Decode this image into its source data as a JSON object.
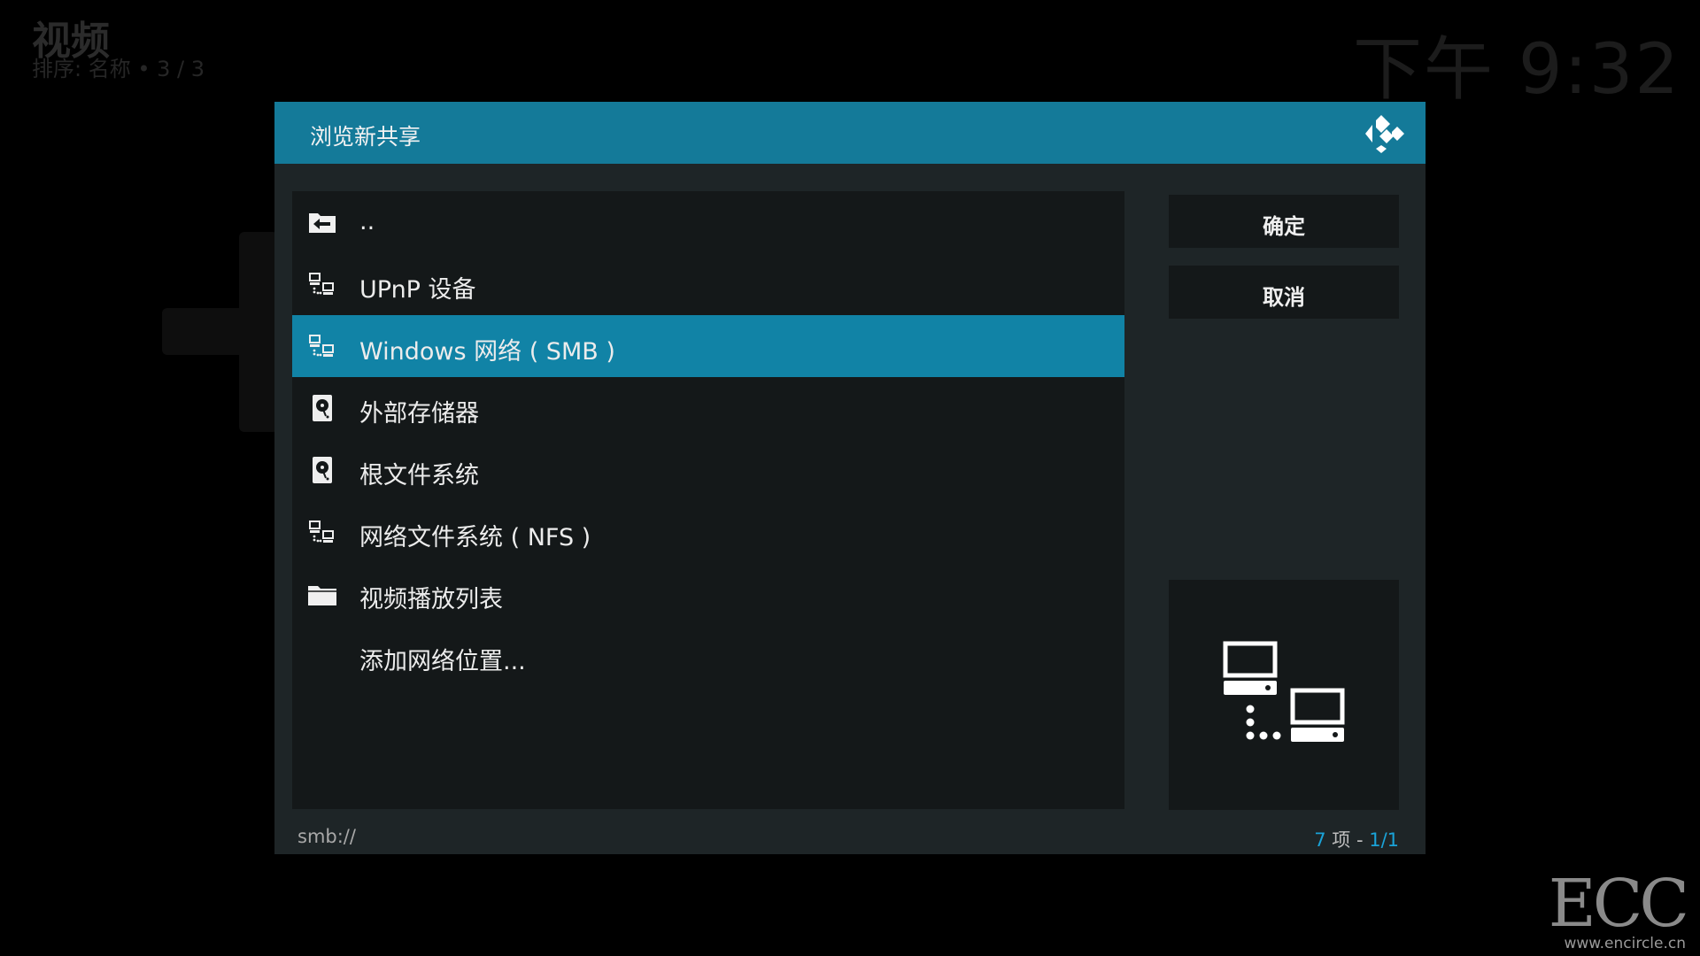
{
  "background": {
    "title": "视频",
    "subtitle": "排序: 名称  •  3 / 3",
    "clock": "下午 9:32"
  },
  "dialog": {
    "title": "浏览新共享",
    "logo_icon": "kodi-logo-icon",
    "items": [
      {
        "label": "..",
        "icon": "folder-back-icon"
      },
      {
        "label": "UPnP 设备",
        "icon": "network-icon"
      },
      {
        "label": "Windows 网络 ( SMB )",
        "icon": "network-icon",
        "selected": true
      },
      {
        "label": "外部存储器",
        "icon": "harddisk-icon"
      },
      {
        "label": "根文件系统",
        "icon": "harddisk-icon"
      },
      {
        "label": "网络文件系统 ( NFS )",
        "icon": "network-icon"
      },
      {
        "label": "视频播放列表",
        "icon": "folder-icon"
      },
      {
        "label": "添加网络位置...",
        "icon": ""
      }
    ],
    "buttons": {
      "ok": "确定",
      "cancel": "取消"
    },
    "preview_icon": "network-computers-icon",
    "footer": {
      "path": "smb://",
      "count_number": "7",
      "count_unit": " 项 - ",
      "page": "1/1"
    }
  },
  "watermark": {
    "logo": "ECC",
    "url": "www.encircle.cn"
  },
  "colors": {
    "accent": "#147a99",
    "selected": "#1183a6",
    "count_accent": "#1aa3d8"
  }
}
